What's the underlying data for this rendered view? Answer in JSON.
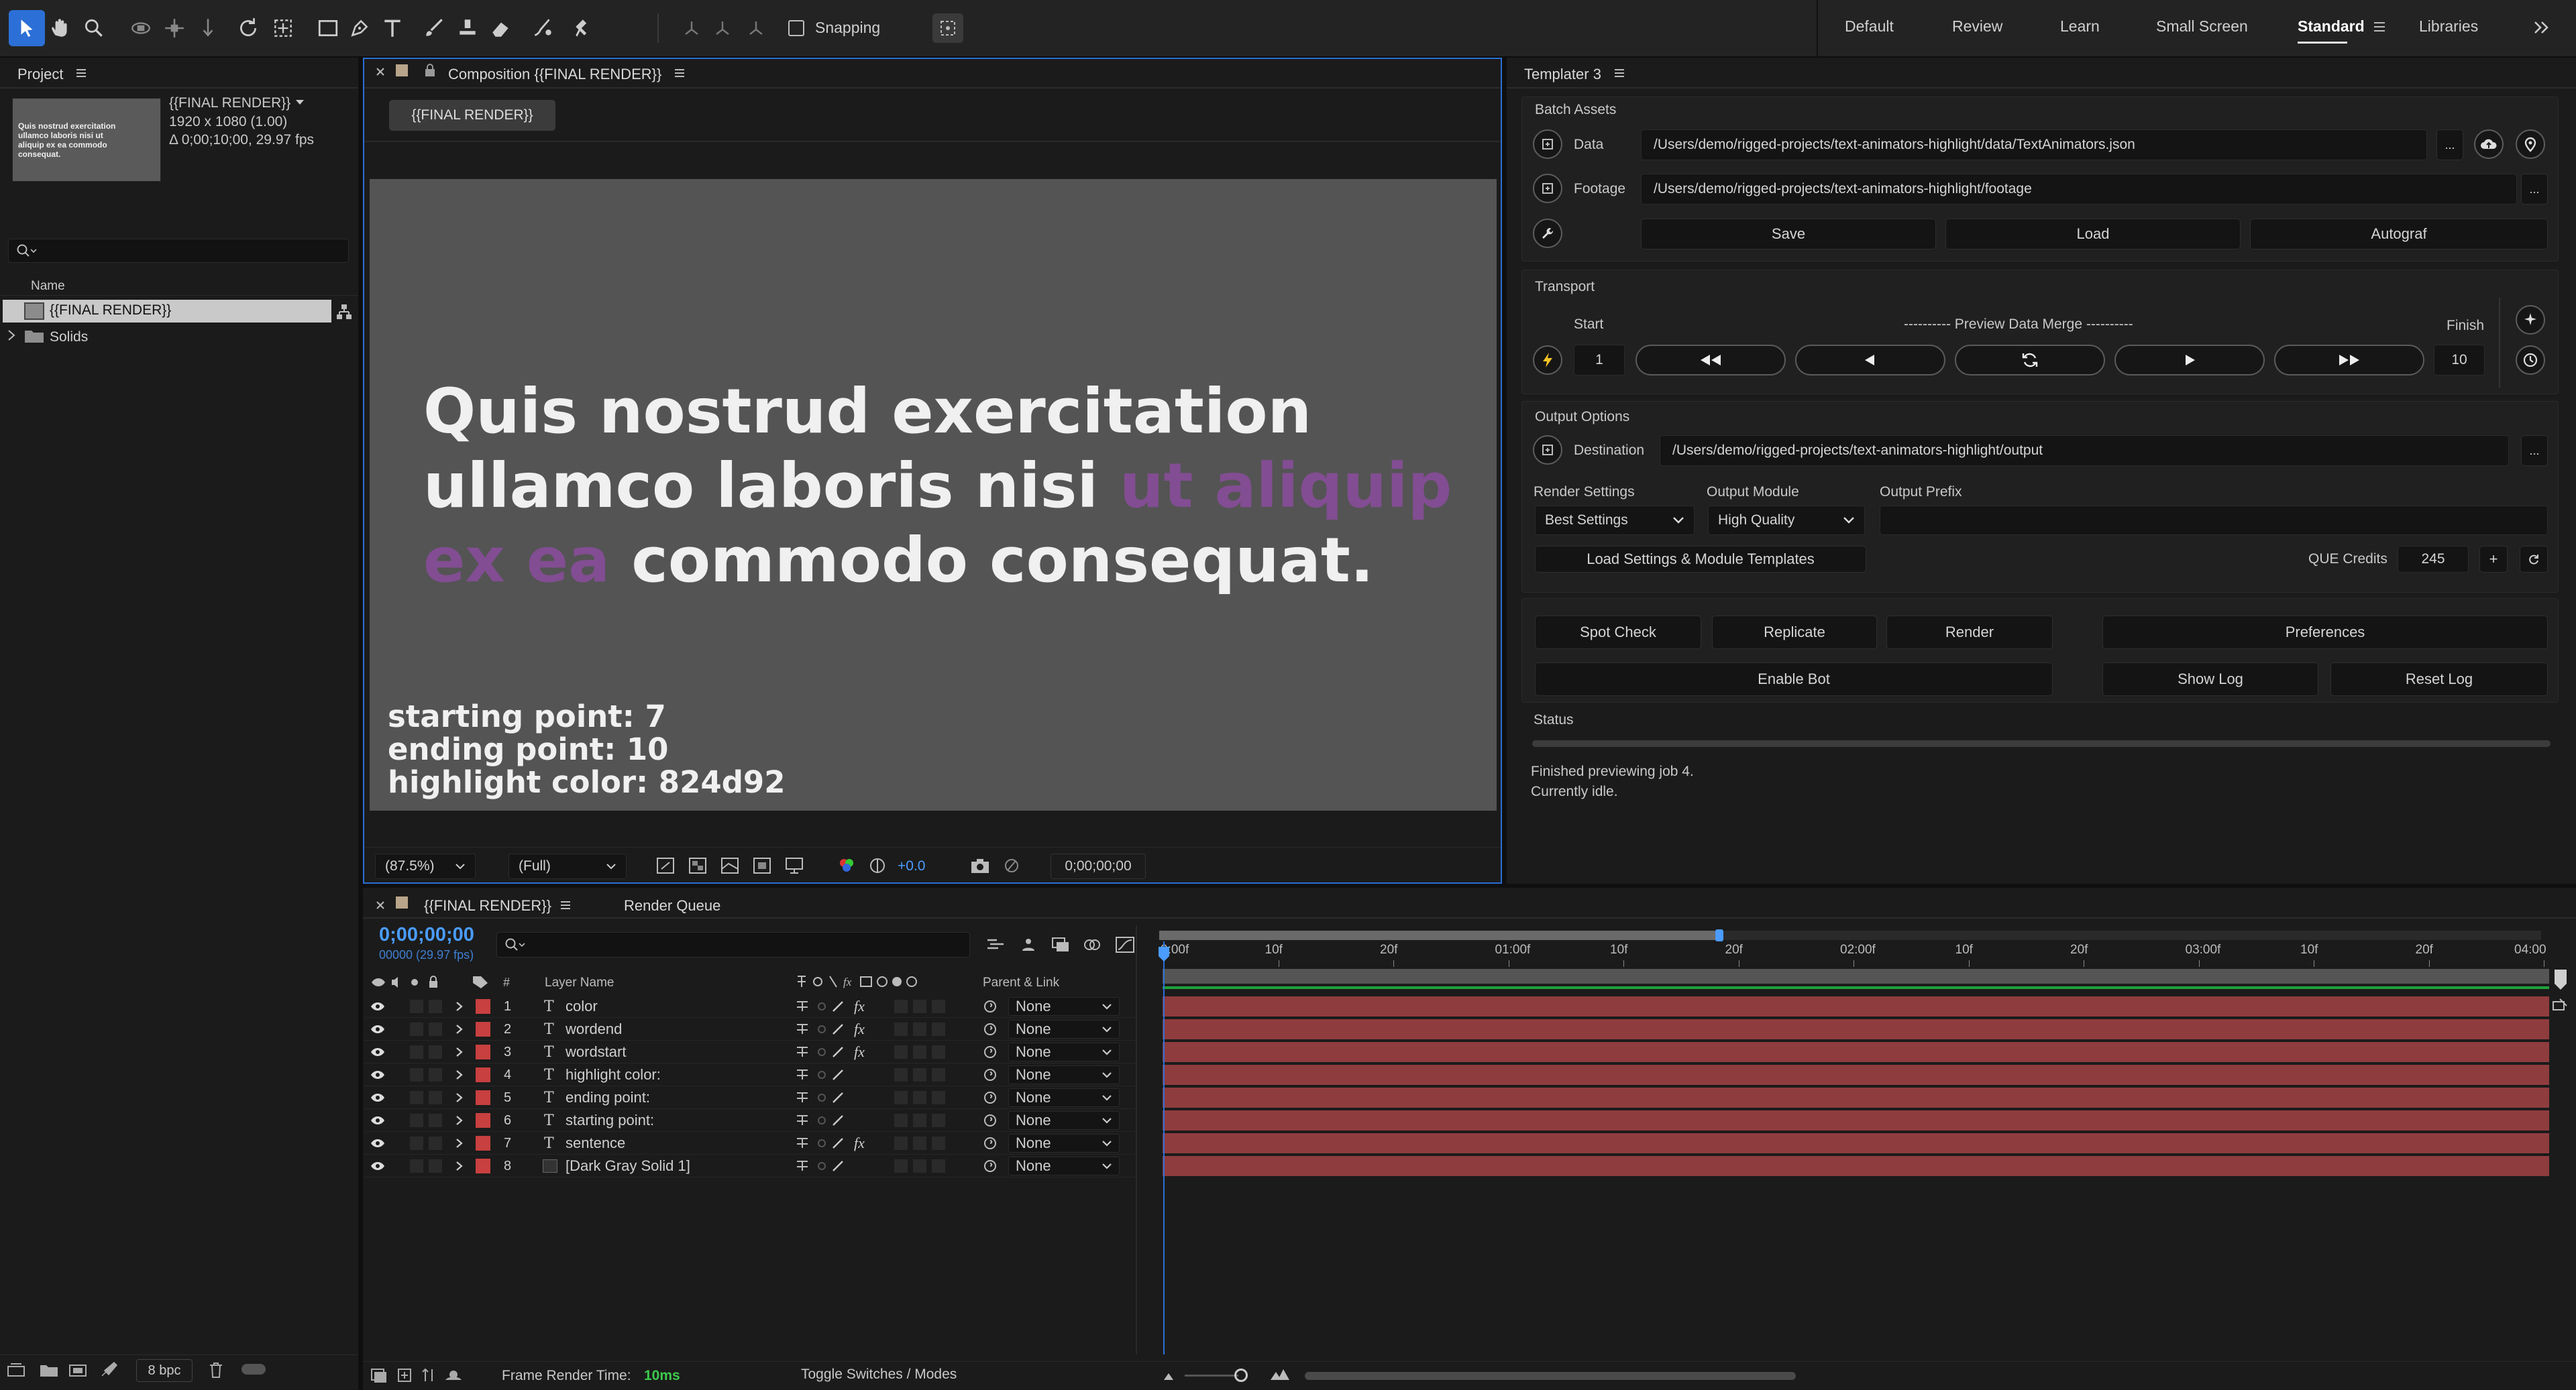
{
  "toolbar": {
    "snapping_label": "Snapping",
    "tools": [
      "selection-tool",
      "hand-tool",
      "zoom-tool",
      "orbit-camera-tool",
      "pan-camera-tool",
      "dolly-camera-tool",
      "rotation-tool",
      "pan-behind-tool",
      "rectangle-tool",
      "pen-tool",
      "type-tool",
      "brush-tool",
      "clone-stamp-tool",
      "eraser-tool",
      "roto-brush-tool",
      "puppet-tool"
    ]
  },
  "workspaces": [
    "Default",
    "Review",
    "Learn",
    "Small Screen",
    "Standard",
    "Libraries"
  ],
  "project": {
    "title": "Project",
    "comp_name": "{{FINAL RENDER}}",
    "comp_size": "1920 x 1080 (1.00)",
    "comp_duration": "Δ 0;00;10;00, 29.97 fps",
    "thumb_text": "Quis nostrud exercitation ullamco laboris nisi ut aliquip ex ea commodo consequat.",
    "name_col": "Name",
    "items": [
      "{{FINAL RENDER}}",
      "Solids"
    ],
    "bpc": "8 bpc"
  },
  "composition": {
    "tab": "Composition {{FINAL RENDER}}",
    "chip": "{{FINAL RENDER}}",
    "line1": "Quis nostrud exercitation",
    "line2a": "ullamco laboris nisi ",
    "line2b": "ut aliquip",
    "line3a": "ex ea",
    "line3b": " commodo consequat.",
    "info1": "starting point: 7",
    "info2": "ending point: 10",
    "info3": "highlight color: 824d92",
    "zoom": "(87.5%)",
    "resolution": "(Full)",
    "exposure": "+0.0",
    "timecode": "0;00;00;00",
    "highlight_color": "#824d92"
  },
  "templater": {
    "title": "Templater 3",
    "batch_assets": "Batch Assets",
    "data_label": "Data",
    "data_path": "/Users/demo/rigged-projects/text-animators-highlight/data/TextAnimators.json",
    "footage_label": "Footage",
    "footage_path": "/Users/demo/rigged-projects/text-animators-highlight/footage",
    "ellipsis": "...",
    "save": "Save",
    "load": "Load",
    "autograf": "Autograf",
    "transport": "Transport",
    "start": "Start",
    "finish": "Finish",
    "preview": "---------- Preview Data Merge ----------",
    "start_val": "1",
    "finish_val": "10",
    "output_options": "Output Options",
    "destination_label": "Destination",
    "destination_path": "/Users/demo/rigged-projects/text-animators-highlight/output",
    "render_settings_label": "Render Settings",
    "output_module_label": "Output Module",
    "output_prefix_label": "Output Prefix",
    "render_settings_val": "Best Settings",
    "output_module_val": "High Quality",
    "load_templates": "Load Settings & Module Templates",
    "que_credits_label": "QUE Credits",
    "que_credits_val": "245",
    "plus": "+",
    "spot_check": "Spot Check",
    "replicate": "Replicate",
    "render": "Render",
    "preferences": "Preferences",
    "enable_bot": "Enable Bot",
    "show_log": "Show Log",
    "reset_log": "Reset Log",
    "status_label": "Status",
    "status_line1": "Finished previewing job 4.",
    "status_line2": "Currently idle."
  },
  "timeline": {
    "tab": "{{FINAL RENDER}}",
    "render_queue": "Render Queue",
    "timecode": "0;00;00;00",
    "fps": "00000 (29.97 fps)",
    "hash_col": "#",
    "layer_name_col": "Layer Name",
    "parent_col": "Parent & Link",
    "ruler": [
      "0:00f",
      "10f",
      "20f",
      "01:00f",
      "10f",
      "20f",
      "02:00f",
      "10f",
      "20f",
      "03:00f",
      "10f",
      "20f",
      "04:00"
    ],
    "layers": [
      {
        "num": "1",
        "type": "T",
        "name": "color",
        "fx": "fx",
        "parent": "None"
      },
      {
        "num": "2",
        "type": "T",
        "name": "wordend",
        "fx": "fx",
        "parent": "None"
      },
      {
        "num": "3",
        "type": "T",
        "name": "wordstart",
        "fx": "fx",
        "parent": "None"
      },
      {
        "num": "4",
        "type": "T",
        "name": "highlight color:",
        "fx": "",
        "parent": "None"
      },
      {
        "num": "5",
        "type": "T",
        "name": "ending point:",
        "fx": "",
        "parent": "None"
      },
      {
        "num": "6",
        "type": "T",
        "name": "starting point:",
        "fx": "",
        "parent": "None"
      },
      {
        "num": "7",
        "type": "T",
        "name": "sentence",
        "fx": "fx",
        "parent": "None"
      },
      {
        "num": "8",
        "type": "",
        "name": "[Dark Gray Solid 1]",
        "fx": "",
        "parent": "None"
      }
    ],
    "frame_render_label": "Frame Render Time:",
    "frame_render_val": "10ms",
    "toggle_modes": "Toggle Switches / Modes"
  },
  "colors": {
    "accent": "#2c6fd6",
    "layer_label": "#c8403f",
    "layer_bar": "#8f3c3e",
    "timecode": "#4a9cff",
    "highlight": "#824d92"
  }
}
